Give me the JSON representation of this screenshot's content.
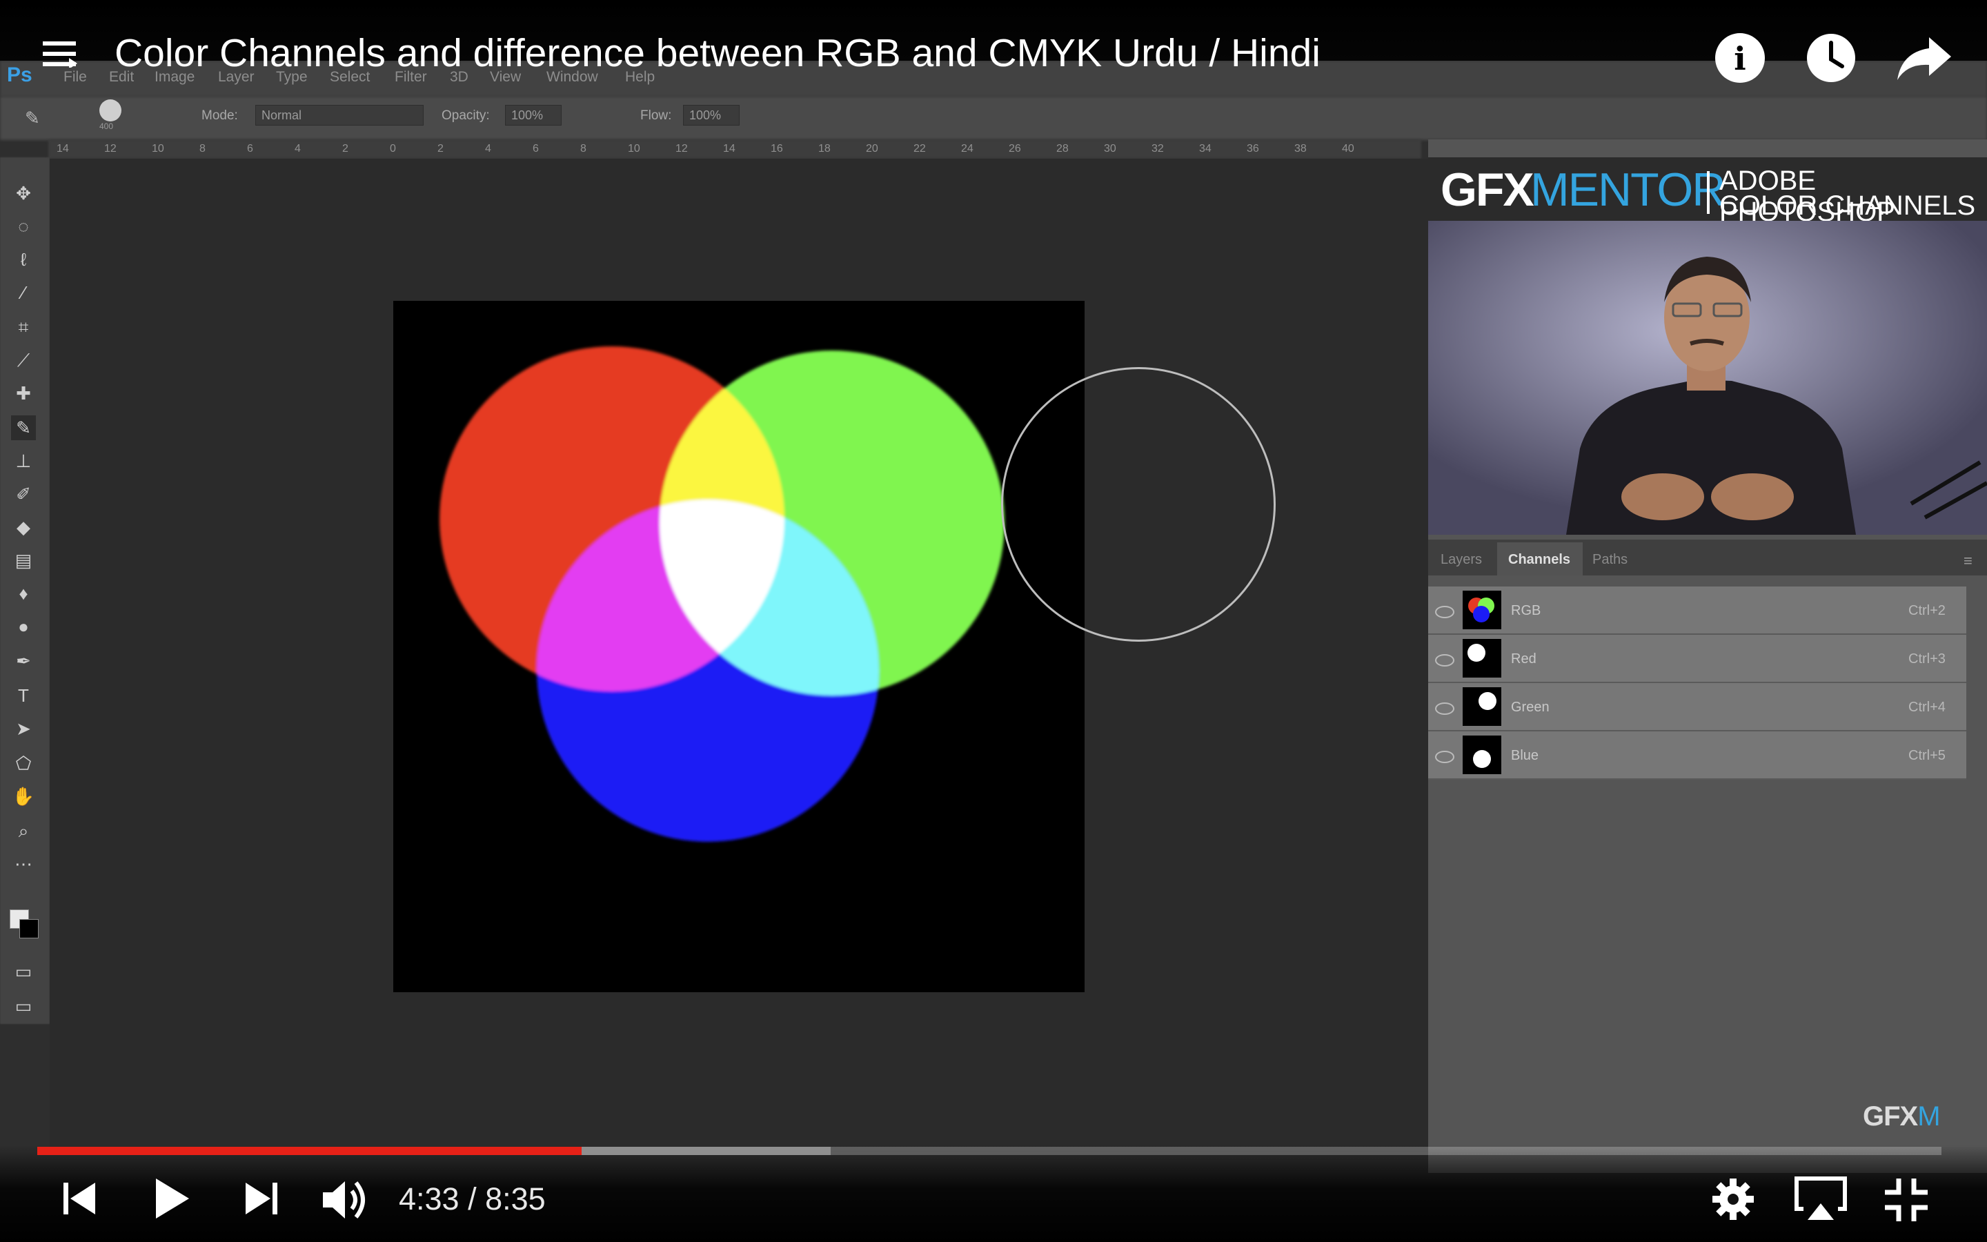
{
  "video": {
    "title": "Color Channels and difference between RGB and CMYK Urdu / Hindi",
    "current_time": "4:33",
    "duration": "8:35",
    "time_display": "4:33 / 8:35",
    "progress_fraction": 0.2857,
    "buffered_fraction": 0.4167
  },
  "photoshop": {
    "logo": "Ps",
    "menu": [
      "File",
      "Edit",
      "Image",
      "Layer",
      "Type",
      "Select",
      "Filter",
      "3D",
      "View",
      "Window",
      "Help"
    ],
    "options": {
      "brush_size": "400",
      "mode_label": "Mode:",
      "mode_value": "Normal",
      "opacity_label": "Opacity:",
      "opacity_value": "100%",
      "flow_label": "Flow:",
      "flow_value": "100%"
    },
    "ruler_ticks": [
      "14",
      "12",
      "10",
      "8",
      "6",
      "4",
      "2",
      "0",
      "2",
      "4",
      "6",
      "8",
      "10",
      "12",
      "14",
      "16",
      "18",
      "20",
      "22",
      "24",
      "26",
      "28",
      "30",
      "32",
      "34",
      "36",
      "38",
      "40"
    ],
    "canvas": {
      "circles": [
        {
          "name": "red",
          "color": "#e53a24"
        },
        {
          "name": "green",
          "color": "#80f550"
        },
        {
          "name": "blue",
          "color": "#1c1cf5"
        }
      ],
      "overlaps": {
        "red_green": "#fbf640",
        "red_blue": "#e33cf2",
        "green_blue": "#7ff6fb",
        "all": "#ffffff"
      }
    },
    "panel_tabs": [
      "Layers",
      "Channels",
      "Paths"
    ],
    "active_tab": "Channels",
    "channels": [
      {
        "name": "RGB",
        "shortcut": "Ctrl+2"
      },
      {
        "name": "Red",
        "shortcut": "Ctrl+3"
      },
      {
        "name": "Green",
        "shortcut": "Ctrl+4"
      },
      {
        "name": "Blue",
        "shortcut": "Ctrl+5"
      }
    ]
  },
  "branding": {
    "gfx": "GFX",
    "mentor": "MENTOR",
    "subtitle_line1": "ADOBE PHOTOSHOP",
    "subtitle_line2": "COLOR CHANNELS",
    "watermark_main": "GFX",
    "watermark_accent": "M",
    "accent_color": "#34a4df"
  },
  "icons": {
    "top": [
      "menu-icon",
      "info-icon",
      "watch-later-icon",
      "share-icon"
    ],
    "controls": [
      "previous-icon",
      "play-icon",
      "next-icon",
      "volume-icon",
      "settings-icon",
      "airplay-icon",
      "exit-fullscreen-icon"
    ]
  },
  "colors": {
    "progress_played": "#e62117",
    "progress_buffered": "#8f8f8f"
  }
}
